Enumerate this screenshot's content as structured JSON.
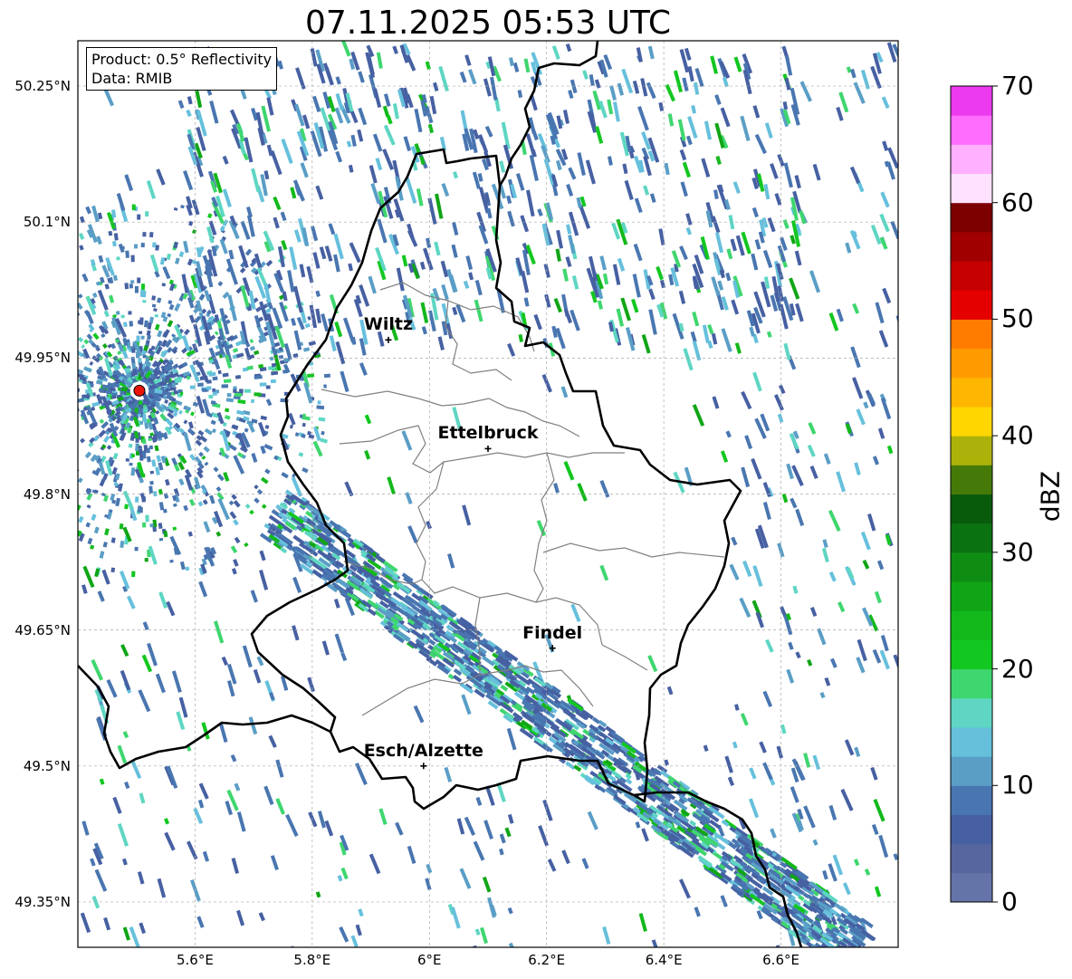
{
  "title": "07.11.2025 05:53 UTC",
  "info": {
    "product": "Product: 0.5° Reflectivity",
    "data": "Data: RMIB"
  },
  "lat_labels": [
    "50.25°N",
    "50.1°N",
    "49.95°N",
    "49.8°N",
    "49.65°N",
    "49.5°N",
    "49.35°N"
  ],
  "lat_values": [
    50.25,
    50.1,
    49.95,
    49.8,
    49.65,
    49.5,
    49.35
  ],
  "lon_labels": [
    "5.6°E",
    "5.8°E",
    "6°E",
    "6.2°E",
    "6.4°E",
    "6.6°E"
  ],
  "lon_values": [
    5.6,
    5.8,
    6.0,
    6.2,
    6.4,
    6.6
  ],
  "extent": {
    "lon_min": 5.4,
    "lon_max": 6.8,
    "lat_min": 49.3,
    "lat_max": 50.3
  },
  "cities": [
    {
      "name": "Wiltz",
      "lon": 5.93,
      "lat": 49.97
    },
    {
      "name": "Ettelbruck",
      "lon": 6.1,
      "lat": 49.85
    },
    {
      "name": "Findel",
      "lon": 6.21,
      "lat": 49.63
    },
    {
      "name": "Esch/Alzette",
      "lon": 5.99,
      "lat": 49.5
    }
  ],
  "radar_site": {
    "lon": 5.505,
    "lat": 49.914,
    "color": "#e8140a"
  },
  "colorbar": {
    "label": "dBZ",
    "ticks": [
      "0",
      "10",
      "20",
      "30",
      "40",
      "50",
      "60",
      "70"
    ],
    "min": 0,
    "max": 70,
    "step": 2.5,
    "colors": [
      "#6574a8",
      "#56679f",
      "#4660a2",
      "#4976b0",
      "#5a9ec6",
      "#66c0dc",
      "#5ed6c3",
      "#3ed66e",
      "#12c71f",
      "#13b81b",
      "#10a516",
      "#0e8d12",
      "#0b7211",
      "#095b0c",
      "#457a09",
      "#adb20a",
      "#ffd600",
      "#ffb600",
      "#ff9b00",
      "#ff7c00",
      "#e50000",
      "#c60000",
      "#a00000",
      "#7c0000",
      "#ffe2ff",
      "#ffb0ff",
      "#ff6dff",
      "#ec3af0"
    ]
  },
  "colors": {
    "national_border": "#000000",
    "canton_border": "#808080",
    "grid": "#aaaaaa"
  }
}
